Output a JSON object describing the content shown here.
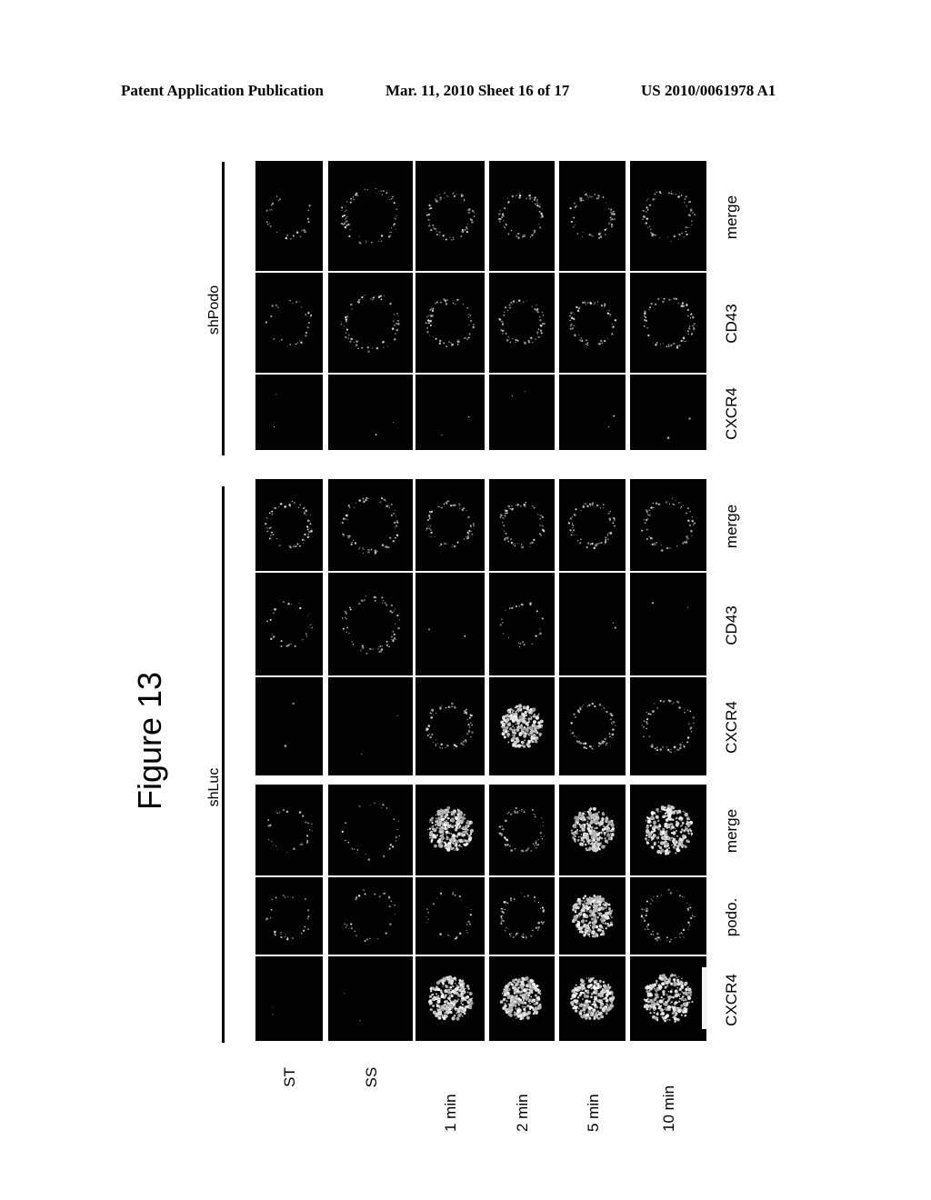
{
  "header": {
    "left": "Patent Application Publication",
    "middle": "Mar. 11, 2010  Sheet 16 of 17",
    "right": "US 2010/0061978 A1"
  },
  "figure": {
    "title": "Figure 13",
    "groups": [
      {
        "label": "shPodo",
        "channels": [
          "CXCR4",
          "CD43",
          "merge"
        ]
      },
      {
        "label": "shLuc",
        "channels": [
          "CXCR4",
          "CD43",
          "merge"
        ]
      },
      {
        "label": "shLuc",
        "channels": [
          "CXCR4",
          "podo.",
          "merge"
        ]
      }
    ],
    "conditions": [
      "ST",
      "SS",
      "1 min",
      "2 min",
      "5 min",
      "10 min"
    ],
    "scale_bar": true
  }
}
